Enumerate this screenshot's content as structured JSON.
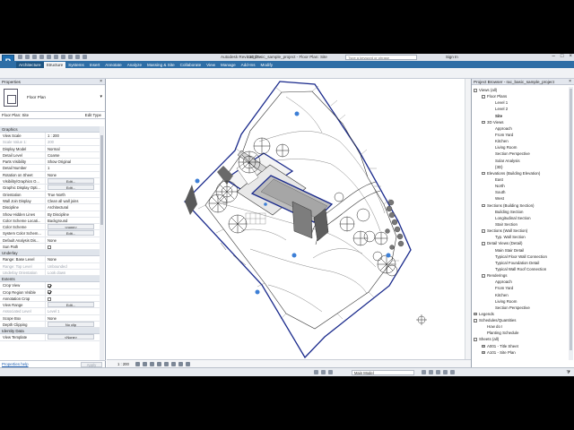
{
  "titlebar": {
    "app_title": "Autodesk Revit 2017 -",
    "doc_title": "rac_basic_sample_project - Floor Plan: Site",
    "search_placeholder": "Type a keyword or phrase",
    "sign_in": "Sign In",
    "logo_letter": "R"
  },
  "ribbon": {
    "tabs": [
      "Architecture",
      "Structure",
      "Systems",
      "Insert",
      "Annotate",
      "Analyze",
      "Massing & Site",
      "Collaborate",
      "View",
      "Manage",
      "Add-Ins",
      "Modify"
    ]
  },
  "properties": {
    "panel_title": "Properties",
    "type_name": "Floor Plan",
    "instance_label": "Floor Plan: Site",
    "edit_type": "Edit Type",
    "groups": [
      {
        "name": "Graphics",
        "rows": [
          {
            "k": "View Scale",
            "v": "1 : 200"
          },
          {
            "k": "Scale Value    1:",
            "v": "200",
            "dim": true
          },
          {
            "k": "Display Model",
            "v": "Normal"
          },
          {
            "k": "Detail Level",
            "v": "Coarse"
          },
          {
            "k": "Parts Visibility",
            "v": "Show Original"
          },
          {
            "k": "Detail Number",
            "v": "1"
          },
          {
            "k": "Rotation on Sheet",
            "v": "None"
          },
          {
            "k": "Visibility/Graphics O...",
            "v": "Edit...",
            "btn": true
          },
          {
            "k": "Graphic Display Opti...",
            "v": "Edit...",
            "btn": true
          },
          {
            "k": "Orientation",
            "v": "True North"
          },
          {
            "k": "Wall Join Display",
            "v": "Clean all wall joins"
          },
          {
            "k": "Discipline",
            "v": "Architectural"
          },
          {
            "k": "Show Hidden Lines",
            "v": "By Discipline"
          },
          {
            "k": "Color Scheme Locati...",
            "v": "Background"
          },
          {
            "k": "Color Scheme",
            "v": "<none>",
            "btn": true
          },
          {
            "k": "System Color Schem...",
            "v": "Edit...",
            "btn": true
          },
          {
            "k": "Default Analysis Dis...",
            "v": "None"
          },
          {
            "k": "Sun Path",
            "v": "",
            "check": false
          }
        ]
      },
      {
        "name": "Underlay",
        "rows": [
          {
            "k": "Range: Base Level",
            "v": "None"
          },
          {
            "k": "Range: Top Level",
            "v": "Unbounded",
            "dim": true
          },
          {
            "k": "Underlay Orientation",
            "v": "Look down",
            "dim": true
          }
        ]
      },
      {
        "name": "Extents",
        "rows": [
          {
            "k": "Crop View",
            "v": "",
            "check": true
          },
          {
            "k": "Crop Region Visible",
            "v": "",
            "check": true
          },
          {
            "k": "Annotation Crop",
            "v": "",
            "check": false
          },
          {
            "k": "View Range",
            "v": "Edit...",
            "btn": true
          },
          {
            "k": "Associated Level",
            "v": "Level 1",
            "dim": true
          },
          {
            "k": "Scope Box",
            "v": "None"
          },
          {
            "k": "Depth Clipping",
            "v": "No clip",
            "btn": true
          }
        ]
      },
      {
        "name": "Identity Data",
        "rows": [
          {
            "k": "View Template",
            "v": "<None>",
            "btn": true
          }
        ]
      }
    ],
    "help_link": "Properties help",
    "apply": "Apply"
  },
  "view_control": {
    "scale": "1 : 200"
  },
  "status": {
    "model": "Main Model"
  },
  "browser": {
    "title": "Project Browser - rac_basic_sample_project",
    "nodes": [
      {
        "t": "Views (all)",
        "d": 0,
        "tog": "-"
      },
      {
        "t": "Floor Plans",
        "d": 1,
        "tog": "-"
      },
      {
        "t": "Level 1",
        "d": 2
      },
      {
        "t": "Level 2",
        "d": 2
      },
      {
        "t": "Site",
        "d": 2,
        "bold": true
      },
      {
        "t": "3D Views",
        "d": 1,
        "tog": "-"
      },
      {
        "t": "Approach",
        "d": 2
      },
      {
        "t": "From Yard",
        "d": 2
      },
      {
        "t": "Kitchen",
        "d": 2
      },
      {
        "t": "Living Room",
        "d": 2
      },
      {
        "t": "Section Perspective",
        "d": 2
      },
      {
        "t": "Solar Analysis",
        "d": 2
      },
      {
        "t": "{3D}",
        "d": 2
      },
      {
        "t": "Elevations (Building Elevation)",
        "d": 1,
        "tog": "-"
      },
      {
        "t": "East",
        "d": 2
      },
      {
        "t": "North",
        "d": 2
      },
      {
        "t": "South",
        "d": 2
      },
      {
        "t": "West",
        "d": 2
      },
      {
        "t": "Sections (Building Section)",
        "d": 1,
        "tog": "-"
      },
      {
        "t": "Building Section",
        "d": 2
      },
      {
        "t": "Longitudinal Section",
        "d": 2
      },
      {
        "t": "Stair Section",
        "d": 2
      },
      {
        "t": "Sections (Wall Section)",
        "d": 1,
        "tog": "-"
      },
      {
        "t": "Typ. Wall Section",
        "d": 2
      },
      {
        "t": "Detail Views (Detail)",
        "d": 1,
        "tog": "-"
      },
      {
        "t": "Main Stair Detail",
        "d": 2
      },
      {
        "t": "Typical Floor Wall Connection",
        "d": 2
      },
      {
        "t": "Typical Foundation Detail",
        "d": 2
      },
      {
        "t": "Typical Wall Roof Connection",
        "d": 2
      },
      {
        "t": "Renderings",
        "d": 1,
        "tog": "-"
      },
      {
        "t": "Approach",
        "d": 2
      },
      {
        "t": "From Yard",
        "d": 2
      },
      {
        "t": "Kitchen",
        "d": 2
      },
      {
        "t": "Living Room",
        "d": 2
      },
      {
        "t": "Section Perspective",
        "d": 2
      },
      {
        "t": "Legends",
        "d": 0,
        "tog": "+"
      },
      {
        "t": "Schedules/Quantities",
        "d": 0,
        "tog": "-"
      },
      {
        "t": "How do I",
        "d": 1
      },
      {
        "t": "Planting Schedule",
        "d": 1
      },
      {
        "t": "Sheets (all)",
        "d": 0,
        "tog": "-"
      },
      {
        "t": "A001 - Title Sheet",
        "d": 1,
        "tog": "+"
      },
      {
        "t": "A101 - Site Plan",
        "d": 1,
        "tog": "+"
      }
    ]
  },
  "colors": {
    "ribbon_blue": "#2e6ea6",
    "crop_blue": "#1a2a8c",
    "tag_blue": "#3d7fd6"
  }
}
